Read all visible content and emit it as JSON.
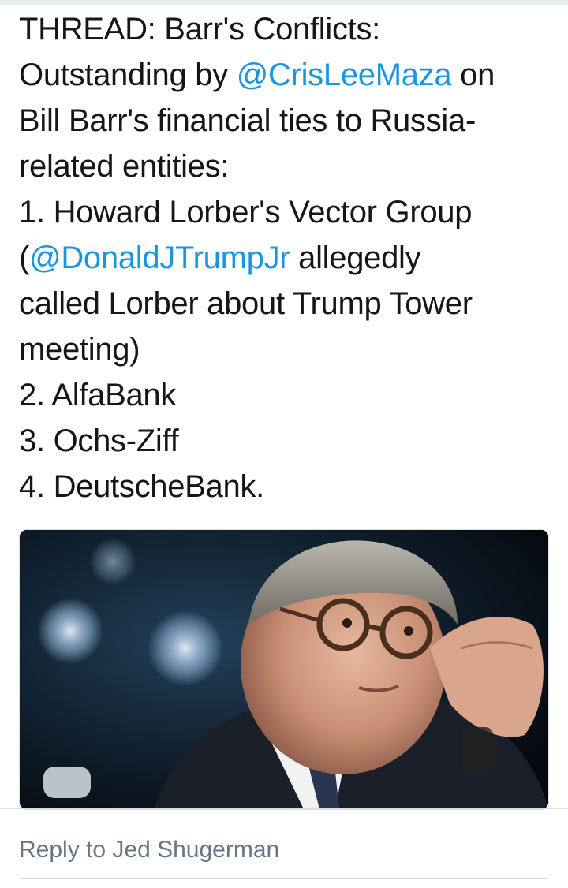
{
  "tweet": {
    "lines": [
      {
        "pre": "THREAD: Barr's Conflicts:",
        "mention": "",
        "post": ""
      },
      {
        "pre": "Outstanding by ",
        "mention": "@CrisLeeMaza",
        "post": " on"
      },
      {
        "pre": "Bill Barr's financial ties to Russia-",
        "mention": "",
        "post": ""
      },
      {
        "pre": "related entities:",
        "mention": "",
        "post": ""
      },
      {
        "pre": "1. Howard Lorber's Vector Group",
        "mention": "",
        "post": ""
      },
      {
        "pre": "(",
        "mention": "@DonaldJTrumpJr",
        "post": " allegedly"
      },
      {
        "pre": "called Lorber about Trump Tower",
        "mention": "",
        "post": ""
      },
      {
        "pre": "meeting)",
        "mention": "",
        "post": ""
      },
      {
        "pre": "2. AlfaBank",
        "mention": "",
        "post": ""
      },
      {
        "pre": "3. Ochs-Ziff",
        "mention": "",
        "post": ""
      },
      {
        "pre": "4. DeutscheBank.",
        "mention": "",
        "post": ""
      }
    ]
  },
  "media": {
    "icon": "photo-of-man-adjusting-glasses"
  },
  "reply": {
    "label": "Reply to Jed Shugerman"
  },
  "colors": {
    "text": "#14171a",
    "mention": "#1b95e0",
    "muted": "#657786",
    "border": "#d8dee2"
  }
}
